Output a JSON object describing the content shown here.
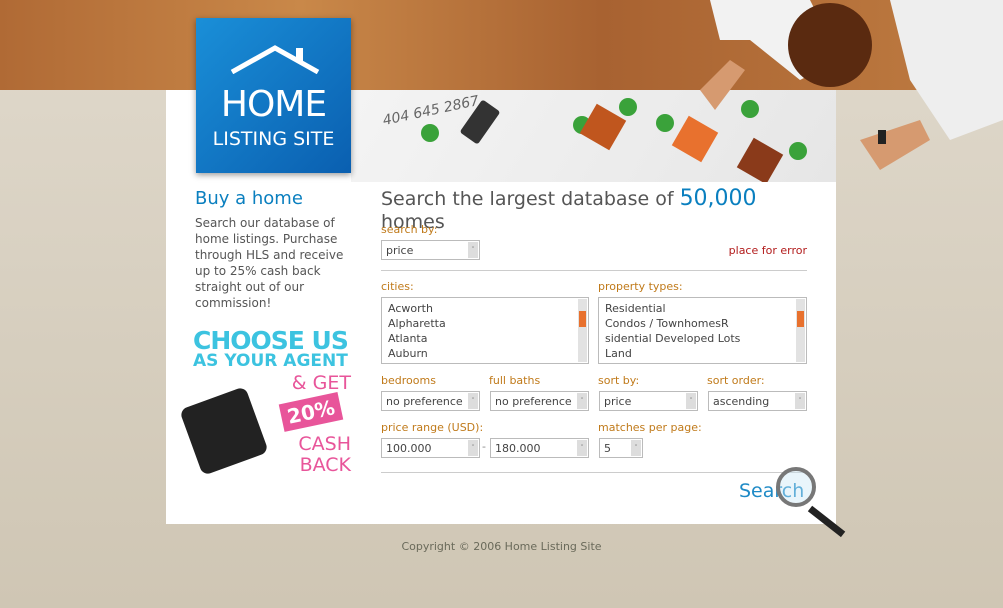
{
  "logo": {
    "line1": "HOME",
    "line2": "LISTING SITE"
  },
  "header": {
    "phone": "404 645 2867"
  },
  "left": {
    "title": "Buy a home",
    "text": "Search our database of home listings. Purchase through HLS and receive up to 25% cash back straight out of our commission!",
    "promo": {
      "line1": "CHOOSE US",
      "line2": "AS YOUR AGENT",
      "line3": "& GET",
      "percent": "20%",
      "line4": "CASH",
      "line5": "BACK"
    }
  },
  "main": {
    "title_pre": "Search the largest database of",
    "title_num": "50,000",
    "title_post": "homes",
    "search_by": {
      "label": "search by:",
      "value": "price"
    },
    "error": "place for error",
    "cities": {
      "label": "cities:",
      "items": [
        "Acworth",
        "Alpharetta",
        "Atlanta",
        "Auburn"
      ]
    },
    "property_types": {
      "label": "property types:",
      "items": [
        "Residential",
        "Condos / TownhomesR",
        "sidential Developed Lots",
        "Land"
      ]
    },
    "bedrooms": {
      "label": "bedrooms",
      "value": "no preference"
    },
    "full_baths": {
      "label": "full baths",
      "value": "no preference"
    },
    "sort_by": {
      "label": "sort by:",
      "value": "price"
    },
    "sort_order": {
      "label": "sort order:",
      "value": "ascending"
    },
    "price_range": {
      "label": "price range (USD):",
      "min": "100.000",
      "separator": "-",
      "max": "180.000"
    },
    "matches": {
      "label": "matches per page:",
      "value": "5"
    },
    "search_button": "Search"
  },
  "footer": "Copyright © 2006 Home Listing Site",
  "colors": {
    "accent": "#0a7fbf",
    "label": "#c07a1a",
    "error": "#b21b1b",
    "promo_pink": "#e8559a"
  }
}
